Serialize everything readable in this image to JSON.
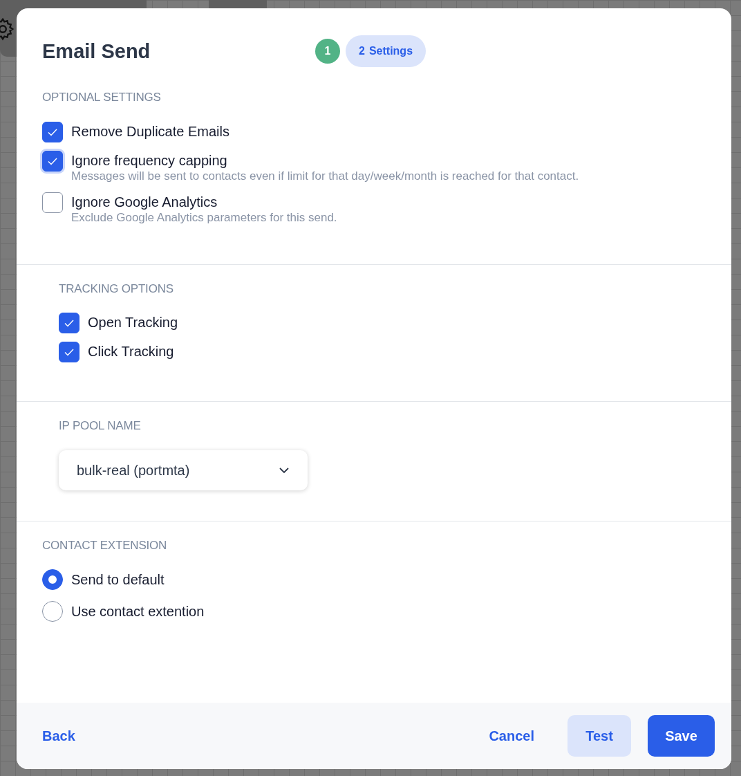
{
  "title": "Email Send",
  "steps": [
    {
      "number": "1",
      "completed": true,
      "selected": false
    },
    {
      "number": "2",
      "label": "Settings",
      "selected": true
    }
  ],
  "sections": [
    {
      "heading": "OPTIONAL SETTINGS",
      "indented": false,
      "kind": "checkboxes",
      "items": [
        {
          "label": "Remove Duplicate Emails",
          "checked": true,
          "focused": false
        },
        {
          "label": "Ignore frequency capping",
          "description": "Messages will be sent to contacts even if limit for that day/week/month is reached for that contact.",
          "checked": true,
          "focused": true
        },
        {
          "label": "Ignore Google Analytics",
          "description": "Exclude Google Analytics parameters for this send.",
          "checked": false,
          "focused": false
        }
      ]
    },
    {
      "heading": "TRACKING OPTIONS",
      "indented": true,
      "kind": "checkboxes",
      "items": [
        {
          "label": "Open Tracking",
          "checked": true,
          "focused": false
        },
        {
          "label": "Click Tracking",
          "checked": true,
          "focused": false
        }
      ]
    },
    {
      "heading": "IP POOL NAME",
      "indented": true,
      "kind": "select",
      "value": "bulk-real (portmta)"
    },
    {
      "heading": "CONTACT EXTENSION",
      "indented": false,
      "kind": "radios",
      "items": [
        {
          "label": "Send to default",
          "selected": true
        },
        {
          "label": "Use contact extention",
          "selected": false
        }
      ]
    }
  ],
  "footer": {
    "back": "Back",
    "cancel": "Cancel",
    "test": "Test",
    "save": "Save"
  }
}
